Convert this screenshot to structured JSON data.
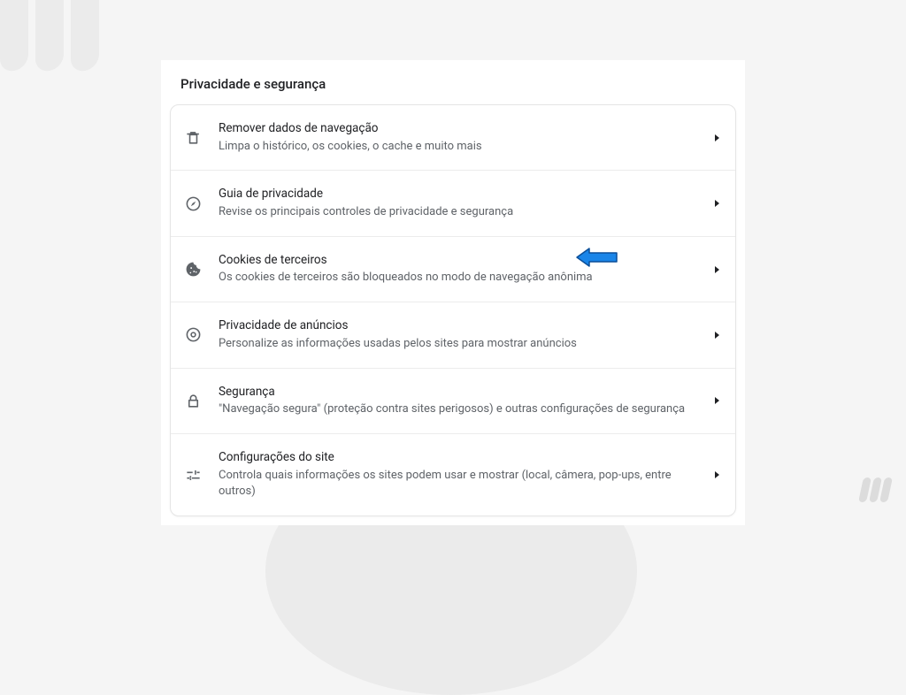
{
  "section": {
    "title": "Privacidade e segurança",
    "rows": [
      {
        "icon": "trash-icon",
        "title": "Remover dados de navegação",
        "subtitle": "Limpa o histórico, os cookies, o cache e muito mais"
      },
      {
        "icon": "compass-icon",
        "title": "Guia de privacidade",
        "subtitle": "Revise os principais controles de privacidade e segurança"
      },
      {
        "icon": "cookie-icon",
        "title": "Cookies de terceiros",
        "subtitle": "Os cookies de terceiros são bloqueados no modo de navegação anônima"
      },
      {
        "icon": "ad-privacy-icon",
        "title": "Privacidade de anúncios",
        "subtitle": "Personalize as informações usadas pelos sites para mostrar anúncios"
      },
      {
        "icon": "lock-icon",
        "title": "Segurança",
        "subtitle": "\"Navegação segura\" (proteção contra sites perigosos) e outras configurações de segurança"
      },
      {
        "icon": "tune-icon",
        "title": "Configurações do site",
        "subtitle": "Controla quais informações os sites podem usar e mostrar (local, câmera, pop-ups, entre outros)"
      }
    ]
  },
  "annotation": {
    "color": "#1a85e8"
  }
}
